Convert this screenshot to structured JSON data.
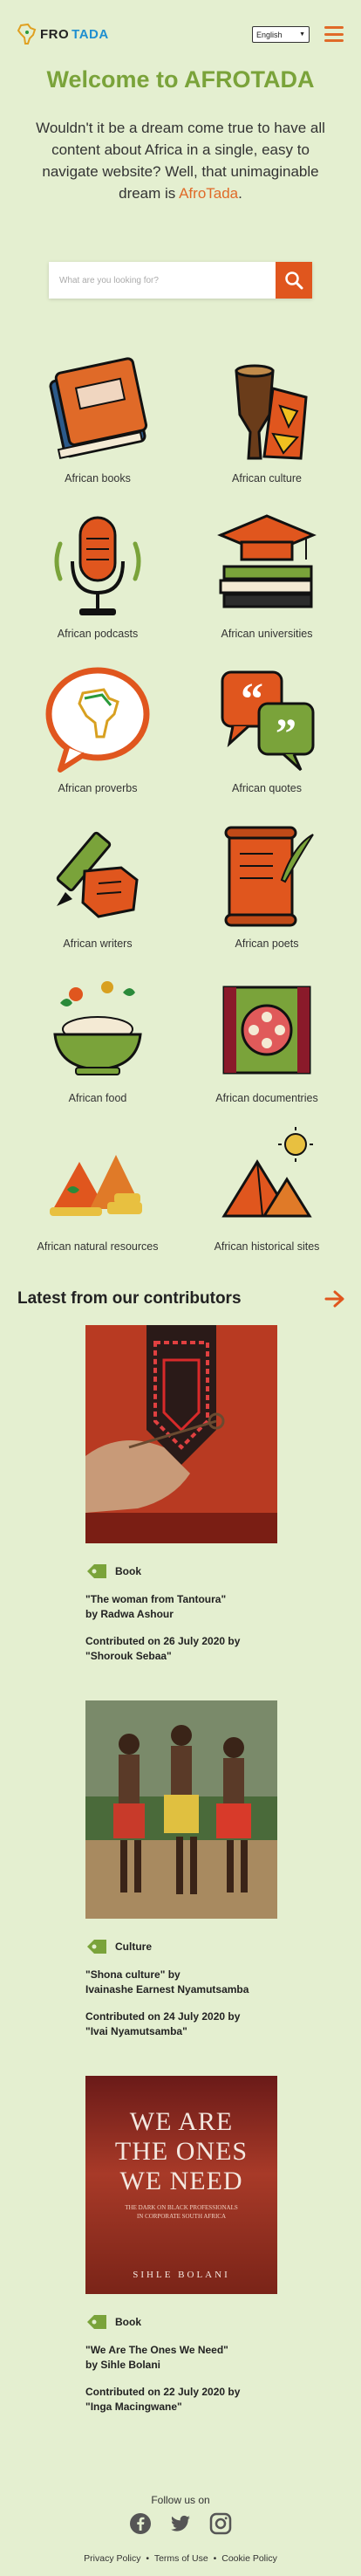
{
  "header": {
    "logo_a": "A",
    "logo_rest": "FRO",
    "logo_tada": "TADA",
    "language": "English"
  },
  "hero": {
    "title": "Welcome to AFROTADA",
    "text": "Wouldn't it be a dream come true to have all content about Africa in a single, easy to navigate website? Well, that unimaginable dream is",
    "brand": "AfroTada",
    "period": "."
  },
  "search": {
    "placeholder": "What are you looking for?"
  },
  "categories": [
    {
      "label": "African books",
      "icon": "book-icon"
    },
    {
      "label": "African culture",
      "icon": "drum-icon"
    },
    {
      "label": "African podcasts",
      "icon": "microphone-icon"
    },
    {
      "label": "African universities",
      "icon": "graduation-cap-icon"
    },
    {
      "label": "African proverbs",
      "icon": "africa-speech-bubble-icon"
    },
    {
      "label": "African quotes",
      "icon": "quote-bubbles-icon"
    },
    {
      "label": "African writers",
      "icon": "pen-hand-icon"
    },
    {
      "label": "African poets",
      "icon": "scroll-quill-icon"
    },
    {
      "label": "African food",
      "icon": "food-bowl-icon"
    },
    {
      "label": "African documentries",
      "icon": "film-reel-icon"
    },
    {
      "label": "African natural resources",
      "icon": "gold-mountains-icon"
    },
    {
      "label": "African historical sites",
      "icon": "pyramids-icon"
    }
  ],
  "latest": {
    "title": "Latest from our contributors",
    "cards": [
      {
        "tag": "Book",
        "title_line1": "\"The woman from Tantoura\"",
        "title_line2": "by Radwa Ashour",
        "contrib_line1": "Contributed on 26 July 2020 by",
        "contrib_line2": "\"Shorouk Sebaa\""
      },
      {
        "tag": "Culture",
        "title_line1": "\"Shona culture\" by",
        "title_line2": "Ivainashe Earnest Nyamutsamba",
        "contrib_line1": "Contributed on 24 July 2020 by",
        "contrib_line2": "\"Ivai Nyamutsamba\""
      },
      {
        "tag": "Book",
        "title_line1": "\"We Are The Ones We Need\"",
        "title_line2": "by Sihle Bolani",
        "contrib_line1": "Contributed on 22 July 2020 by",
        "contrib_line2": "\"Inga Macingwane\"",
        "cover_line1": "WE ARE",
        "cover_line2": "THE ONES",
        "cover_line3": "WE NEED",
        "cover_sub1": "THE DARK ON BLACK PROFESSIONALS",
        "cover_sub2": "IN CORPORATE SOUTH AFRICA",
        "cover_author": "SIHLE BOLANI"
      }
    ]
  },
  "footer": {
    "follow": "Follow us on",
    "privacy": "Privacy Policy",
    "terms": "Terms of Use",
    "cookie": "Cookie Policy",
    "sep": "•"
  },
  "colors": {
    "accent": "#e06a28",
    "green": "#7aa33a",
    "background": "#e4efd0"
  }
}
